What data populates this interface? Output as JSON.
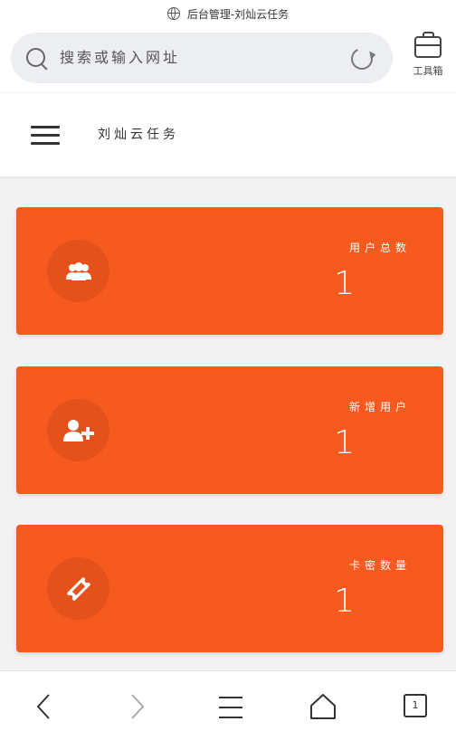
{
  "status": {
    "title": "后台管理-刘灿云任务"
  },
  "browser": {
    "url_placeholder": "搜索或输入网址",
    "toolbox_label": "工具箱"
  },
  "app": {
    "title": "刘灿云任务"
  },
  "cards": [
    {
      "label": "用户总数",
      "value": "1",
      "icon": "users-icon"
    },
    {
      "label": "新增用户",
      "value": "1",
      "icon": "add-user-icon"
    },
    {
      "label": "卡密数量",
      "value": "1",
      "icon": "ticket-icon"
    }
  ],
  "colors": {
    "card": "#f75a1e",
    "circle": "#e4511a",
    "background": "#f2f2f2"
  },
  "nav": [
    "back-icon",
    "forward-icon",
    "menu-icon",
    "home-icon",
    "tabs-icon"
  ],
  "tabs_count": "1"
}
